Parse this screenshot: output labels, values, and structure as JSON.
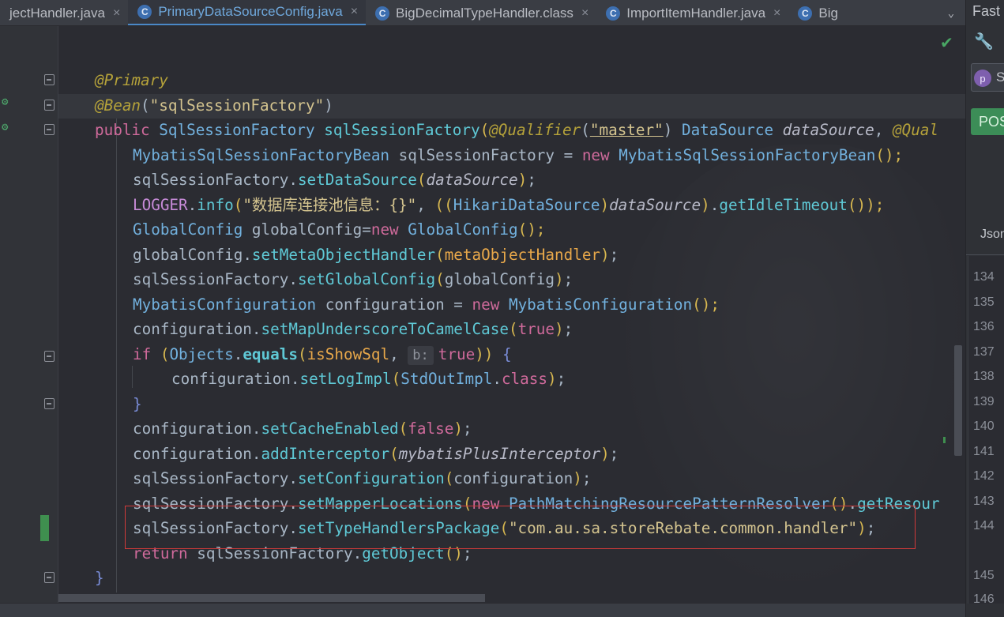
{
  "tabs": [
    {
      "label": "jectHandler.java",
      "close": "×",
      "active": false
    },
    {
      "label": "PrimaryDataSourceConfig.java",
      "close": "×",
      "active": true
    },
    {
      "label": "BigDecimalTypeHandler.class",
      "close": "×",
      "active": false
    },
    {
      "label": "ImportItemHandler.java",
      "close": "×",
      "active": false
    },
    {
      "label": "Big",
      "close": "",
      "active": false
    }
  ],
  "tab_icon_letter": "C",
  "right_panel": {
    "title": "Fast",
    "row_letter": "p",
    "row_text": "S",
    "post_label": "POS",
    "json_label": "Json",
    "line_numbers": [
      "134",
      "135",
      "136",
      "137",
      "138",
      "139",
      "140",
      "141",
      "142",
      "143",
      "144",
      "145",
      "146"
    ]
  },
  "code": {
    "param_hint": "b:",
    "l1_annotation": "@Primary",
    "l2_annotation": "@Bean",
    "l2_string": "\"sqlSessionFactory\"",
    "l3_public": "public",
    "l3_type": "SqlSessionFactory",
    "l3_method": "sqlSessionFactory",
    "l3_qual": "@Qualifier",
    "l3_master": "\"master\"",
    "l3_ds_type": "DataSource",
    "l3_ds_param": "dataSource",
    "l3_qual2": "@Qual",
    "l4_type": "MybatisSqlSessionFactoryBean",
    "l4_var": "sqlSessionFactory",
    "l4_new": "new",
    "l4_ctor": "MybatisSqlSessionFactoryBean",
    "sqlSessionFactory": "sqlSessionFactory",
    "setDataSource": "setDataSource",
    "dataSource": "dataSource",
    "logger": "LOGGER",
    "info": "info",
    "log_string": "\"数据库连接池信息：{}\"",
    "hikari": "HikariDataSource",
    "getIdleTimeout": "getIdleTimeout",
    "globalConfigType": "GlobalConfig",
    "globalConfig": "globalConfig",
    "new": "new",
    "setMetaObjectHandler": "setMetaObjectHandler",
    "metaObjectHandler": "metaObjectHandler",
    "setGlobalConfig": "setGlobalConfig",
    "mybatisConfigType": "MybatisConfiguration",
    "configuration": "configuration",
    "setMapUnderscoreToCamelCase": "setMapUnderscoreToCamelCase",
    "true": "true",
    "false": "false",
    "if": "if",
    "objects": "Objects",
    "equals": "equals",
    "isShowSql": "isShowSql",
    "setLogImpl": "setLogImpl",
    "stdOutImpl": "StdOutImpl",
    "class": "class",
    "setCacheEnabled": "setCacheEnabled",
    "addInterceptor": "addInterceptor",
    "mybatisPlusInterceptor": "mybatisPlusInterceptor",
    "setConfiguration": "setConfiguration",
    "setMapperLocations": "setMapperLocations",
    "pathMatching": "PathMatchingResourcePatternResolver",
    "getResour": "getResour",
    "setTypeHandlersPackage": "setTypeHandlersPackage",
    "handler_package": "\"com.au.sa.storeRebate.common.handler\"",
    "return": "return",
    "getObject": "getObject"
  }
}
